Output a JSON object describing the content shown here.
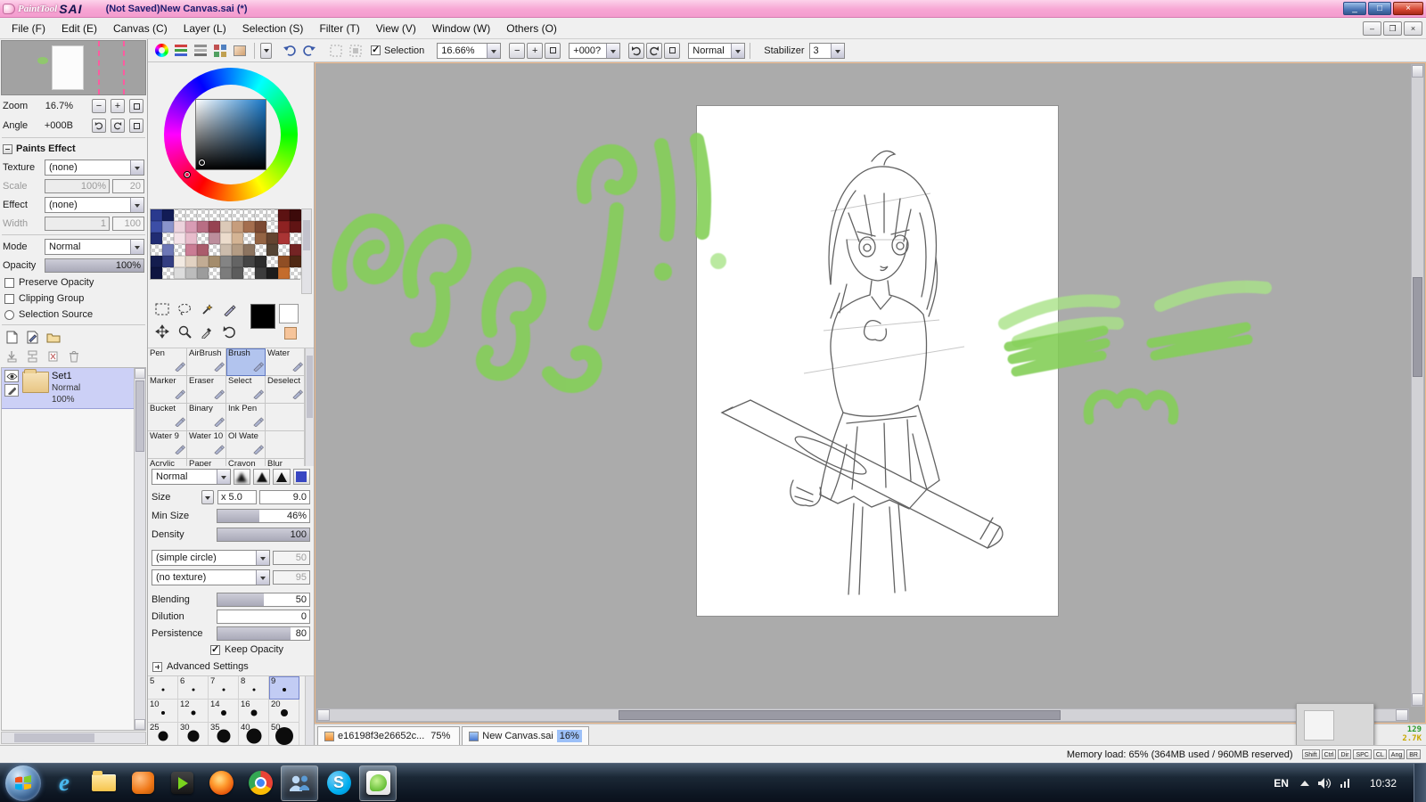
{
  "titlebar": {
    "logo_paint": "PaintTool",
    "logo_sai": "SAI",
    "title": "(Not Saved)New Canvas.sai (*)",
    "minimize": "_",
    "maximize": "□",
    "close": "×"
  },
  "menubar": {
    "items": [
      "File (F)",
      "Edit (E)",
      "Canvas (C)",
      "Layer (L)",
      "Selection (S)",
      "Filter (T)",
      "View (V)",
      "Window (W)",
      "Others (O)"
    ]
  },
  "toolbar": {
    "selection_label": "Selection",
    "zoom_value": "16.66%",
    "zoom_out": "−",
    "zoom_in": "+",
    "angle_value": "+000?",
    "mode_value": "Normal",
    "stabilizer_label": "Stabilizer",
    "stabilizer_value": "3"
  },
  "navigator": {
    "zoom_label": "Zoom",
    "zoom_value": "16.7%",
    "angle_label": "Angle",
    "angle_value": "+000B",
    "btn_minus": "−",
    "btn_plus": "+"
  },
  "paints_effect": {
    "title": "Paints Effect",
    "texture_label": "Texture",
    "texture_value": "(none)",
    "scale_label": "Scale",
    "scale_value": "100%",
    "scale_num": "20",
    "effect_label": "Effect",
    "effect_value": "(none)",
    "width_label": "Width",
    "width_value": "1",
    "width_num": "100"
  },
  "layer_panel": {
    "mode_label": "Mode",
    "mode_value": "Normal",
    "opacity_label": "Opacity",
    "opacity_value": "100%",
    "options": [
      {
        "label": "Preserve Opacity",
        "type": "checkbox",
        "checked": false
      },
      {
        "label": "Clipping Group",
        "type": "checkbox",
        "checked": false
      },
      {
        "label": "Selection Source",
        "type": "radio",
        "checked": false
      }
    ],
    "layers": [
      {
        "name": "Set1",
        "mode": "Normal",
        "opacity": "100%",
        "selected": true
      }
    ]
  },
  "color_panel": {
    "current_color": "#000000",
    "sv_hue": "#1878c8",
    "swatches": [
      "#2a3a8e",
      "#121c56",
      null,
      null,
      null,
      null,
      null,
      null,
      null,
      null,
      null,
      "#5c1212",
      "#3c0a0a",
      "#3c4ea6",
      "#8a94cc",
      "#ecd2dc",
      "#d89cb4",
      "#b86e84",
      "#964352",
      "#dcc9b8",
      "#c69d7c",
      "#a46e4e",
      "#7c4a33",
      null,
      "#8e2222",
      "#601414",
      "#202c72",
      null,
      "#f4e2e8",
      "#e8bccc",
      null,
      "#bc8e9c",
      "#ecdccc",
      "#d4b494",
      null,
      "#946444",
      "#644430",
      "#aa3434",
      null,
      null,
      "#6d77b6",
      null,
      "#ca7c94",
      "#aa5c6c",
      null,
      "#ccbcac",
      "#b49c84",
      "#8c7460",
      null,
      "#544434",
      null,
      "#742424",
      "#141c4e",
      "#343e82",
      "#f2eae2",
      "#e2d2c2",
      "#c2ac94",
      "#a48c6c",
      "#848484",
      "#646464",
      "#444444",
      "#2c2c2c",
      null,
      "#904e24",
      "#4e2814",
      "#0e1440",
      null,
      "#dcdcdc",
      "#bcbcbc",
      "#9c9c9c",
      null,
      "#7c7c7c",
      "#5c5c5c",
      null,
      "#3c3c3c",
      "#1c1c1c",
      "#c46c2c",
      null
    ]
  },
  "brush_panel": {
    "grid": [
      [
        "Pen",
        "AirBrush",
        "Brush",
        "Water"
      ],
      [
        "Marker",
        "Eraser",
        "Select",
        "Deselect"
      ],
      [
        "Bucket",
        "Binary",
        "Ink Pen",
        ""
      ],
      [
        "Water 9",
        "Water 10",
        "Ol Wate",
        ""
      ],
      [
        "Acrylic",
        "Paper",
        "Crayon",
        "Blur"
      ]
    ],
    "selected": "Brush",
    "blend_mode": "Normal",
    "size_label": "Size",
    "size_mult": "x 5.0",
    "size_value": "9.0",
    "minsize_label": "Min Size",
    "minsize_value": "46%",
    "density_label": "Density",
    "density_value": "100",
    "shape_value": "(simple circle)",
    "shape_num": "50",
    "texture_value": "(no texture)",
    "texture_num": "95",
    "blending_label": "Blending",
    "blending_value": "50",
    "dilution_label": "Dilution",
    "dilution_value": "0",
    "persistence_label": "Persistence",
    "persistence_value": "80",
    "keep_opacity_label": "Keep Opacity",
    "advanced_label": "Advanced Settings",
    "sizes": [
      "5",
      "6",
      "7",
      "8",
      "9",
      "10",
      "12",
      "14",
      "16",
      "20",
      "25",
      "30",
      "35",
      "40",
      "50"
    ],
    "selected_size": "9"
  },
  "canvas": {
    "paint_color": "#84cf58",
    "paint_color_light": "#a9e388"
  },
  "doc_tabs": [
    {
      "label": "e16198f3e26652c...",
      "percent": "75%",
      "active": false
    },
    {
      "label": "New Canvas.sai",
      "percent": "16%",
      "active": true
    }
  ],
  "statusbar": {
    "memory": "Memory load: 65% (364MB used / 960MB reserved)",
    "indicators": [
      "Shift",
      "Ctrl",
      "Dir",
      "SPC",
      "CL",
      "Ang",
      "BR"
    ],
    "counter_green": "129",
    "counter_yellow": "2.7K"
  },
  "taskbar": {
    "language": "EN",
    "time": "10:32",
    "icons": [
      {
        "name": "internet-explorer",
        "active": false
      },
      {
        "name": "file-explorer",
        "active": false
      },
      {
        "name": "media-orange",
        "active": false
      },
      {
        "name": "media-play",
        "active": false
      },
      {
        "name": "firefox",
        "active": false
      },
      {
        "name": "chrome",
        "active": false
      },
      {
        "name": "people-messenger",
        "active": true
      },
      {
        "name": "skype",
        "active": false
      },
      {
        "name": "painttool-sai",
        "active": true
      }
    ]
  }
}
